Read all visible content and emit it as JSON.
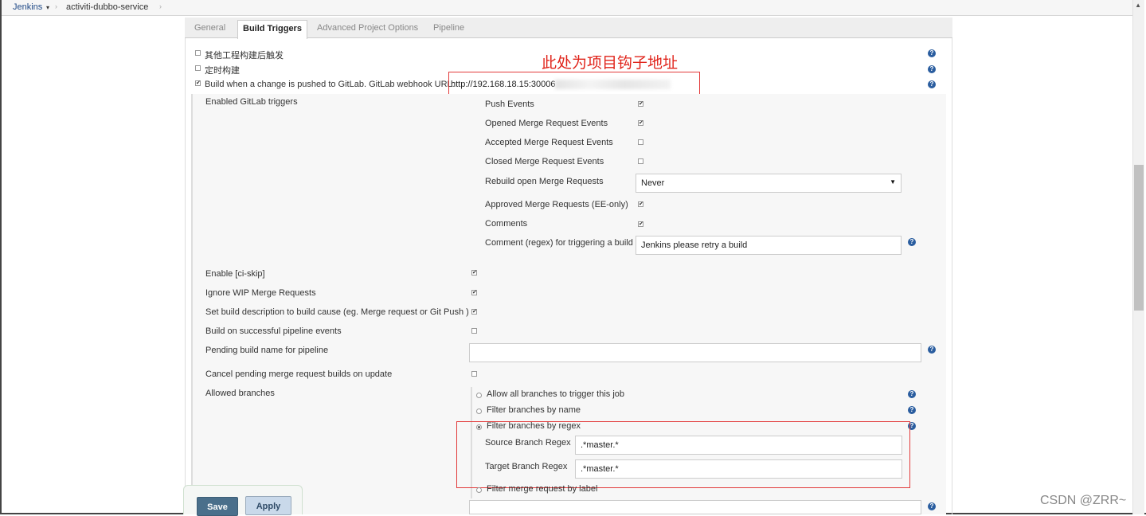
{
  "breadcrumb": {
    "root": "Jenkins",
    "root_arrow": "▾",
    "job": "activiti-dubbo-service",
    "sep": "›"
  },
  "tabs": [
    {
      "label": "General"
    },
    {
      "label": "Build Triggers"
    },
    {
      "label": "Advanced Project Options"
    },
    {
      "label": "Pipeline"
    }
  ],
  "annotation": "此处为项目钩子地址",
  "triggers": {
    "other_projects": "其他工程构建后触发",
    "timer": "定时构建",
    "gitlab_prefix": "Build when a change is pushed to GitLab. GitLab webhook URL:",
    "gitlab_url": "http://192.168.18.15:30006"
  },
  "gitlab": {
    "enabled_triggers_label": "Enabled GitLab triggers",
    "push_events": "Push Events",
    "opened_mr": "Opened Merge Request Events",
    "accepted_mr": "Accepted Merge Request Events",
    "closed_mr": "Closed Merge Request Events",
    "rebuild_open_mr": "Rebuild open Merge Requests",
    "rebuild_value": "Never",
    "approved_mr": "Approved Merge Requests (EE-only)",
    "comments": "Comments",
    "comment_regex_label": "Comment (regex) for triggering a build",
    "comment_regex_value": "Jenkins please retry a build",
    "ci_skip": "Enable [ci-skip]",
    "ignore_wip": "Ignore WIP Merge Requests",
    "set_description": "Set build description to build cause (eg. Merge request or Git Push )",
    "successful_pipeline": "Build on successful pipeline events",
    "pending_build_name": "Pending build name for pipeline",
    "cancel_pending": "Cancel pending merge request builds on update",
    "allowed_branches": "Allowed branches",
    "allow_all": "Allow all branches to trigger this job",
    "filter_by_name": "Filter branches by name",
    "filter_by_regex": "Filter branches by regex",
    "source_regex_label": "Source Branch Regex",
    "source_regex_value": ".*master.*",
    "target_regex_label": "Target Branch Regex",
    "target_regex_value": ".*master.*",
    "filter_by_label": "Filter merge request by label"
  },
  "buttons": {
    "save": "Save",
    "apply": "Apply"
  },
  "icons": {
    "help": "?",
    "check": "✔",
    "dropdown": "▼",
    "scroll_up": "▲"
  },
  "watermark": "CSDN @ZRR~"
}
